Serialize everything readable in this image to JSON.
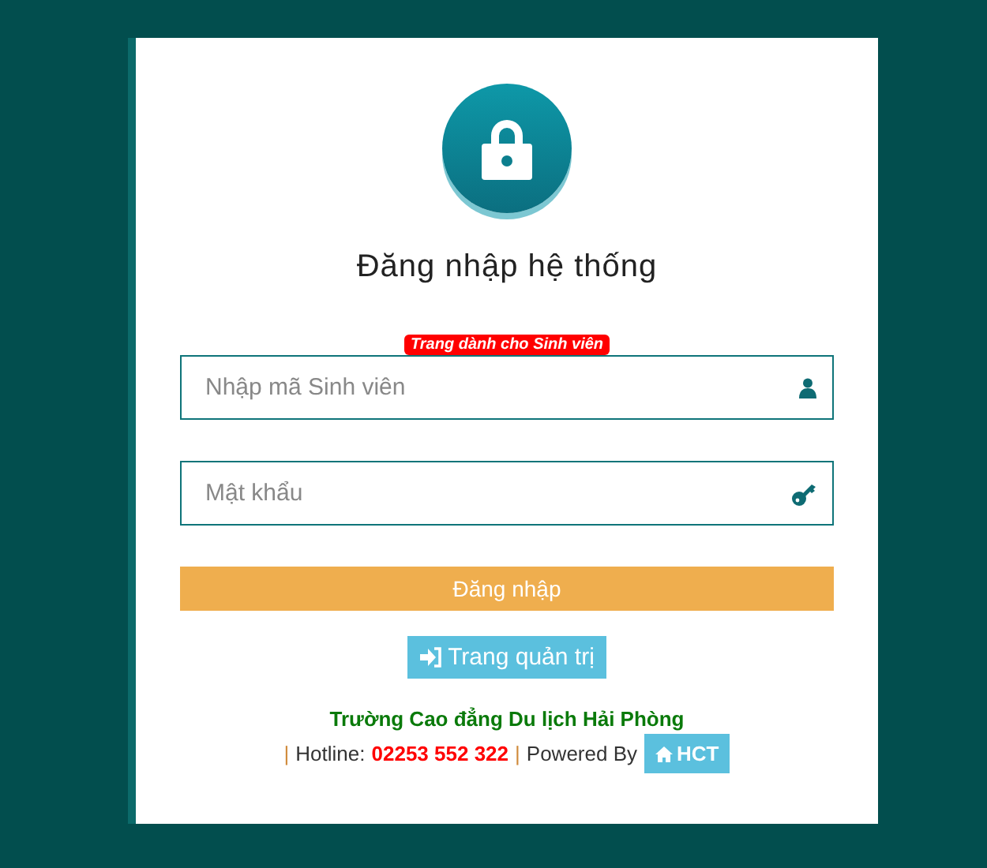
{
  "title": "Đăng nhập hệ thống",
  "badge": "Trang dành cho Sinh viên",
  "fields": [
    {
      "kind": "user",
      "placeholder": "Nhập mã Sinh viên"
    },
    {
      "kind": "key",
      "placeholder": "Mật khẩu"
    }
  ],
  "submit": "Đăng nhập",
  "admin_button": "Trang quản trị",
  "footer": {
    "school": "Trường Cao đẳng Du lịch Hải Phòng",
    "separator_1": "|",
    "hotline_label": "Hotline:",
    "hotline": "02253 552 322",
    "separator_2": "|",
    "powered_by": "Powered By",
    "credit_button": "HCT"
  }
}
